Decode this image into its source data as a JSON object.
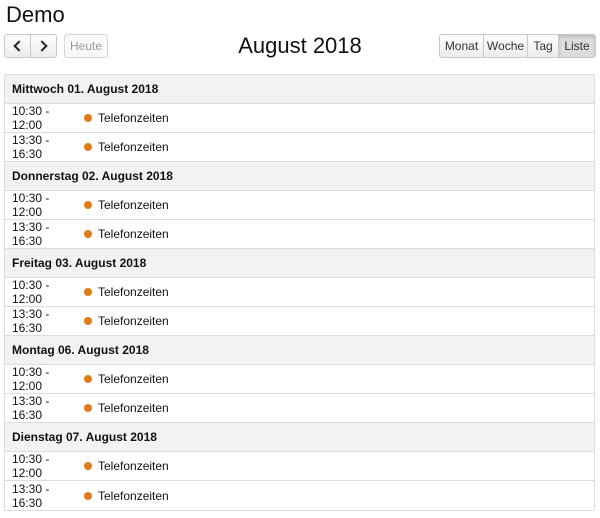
{
  "app": {
    "title": "Demo"
  },
  "toolbar": {
    "prev_icon": "chevron-left-icon",
    "next_icon": "chevron-right-icon",
    "today_label": "Heute",
    "month_title": "August 2018",
    "views": [
      "Monat",
      "Woche",
      "Tag",
      "Liste"
    ],
    "active_view": "Liste"
  },
  "colors": {
    "event_dot": "#e07b1a",
    "day_header_bg": "#f2f2f2",
    "border": "#dddddd"
  },
  "days": [
    {
      "label": "Mittwoch 01. August 2018",
      "events": [
        {
          "time": "10:30 - 12:00",
          "title": "Telefonzeiten"
        },
        {
          "time": "13:30 - 16:30",
          "title": "Telefonzeiten"
        }
      ]
    },
    {
      "label": "Donnerstag 02. August 2018",
      "events": [
        {
          "time": "10:30 - 12:00",
          "title": "Telefonzeiten"
        },
        {
          "time": "13:30 - 16:30",
          "title": "Telefonzeiten"
        }
      ]
    },
    {
      "label": "Freitag 03. August 2018",
      "events": [
        {
          "time": "10:30 - 12:00",
          "title": "Telefonzeiten"
        },
        {
          "time": "13:30 - 16:30",
          "title": "Telefonzeiten"
        }
      ]
    },
    {
      "label": "Montag 06. August 2018",
      "events": [
        {
          "time": "10:30 - 12:00",
          "title": "Telefonzeiten"
        },
        {
          "time": "13:30 - 16:30",
          "title": "Telefonzeiten"
        }
      ]
    },
    {
      "label": "Dienstag 07. August 2018",
      "events": [
        {
          "time": "10:30 - 12:00",
          "title": "Telefonzeiten"
        },
        {
          "time": "13:30 - 16:30",
          "title": "Telefonzeiten"
        }
      ]
    }
  ]
}
